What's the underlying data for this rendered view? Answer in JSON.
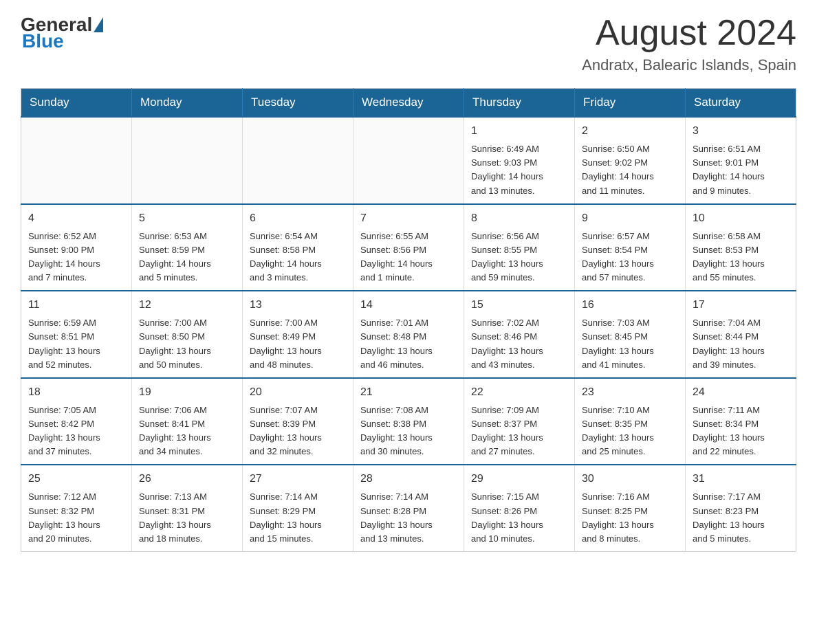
{
  "logo": {
    "general": "General",
    "blue": "Blue"
  },
  "header": {
    "month_title": "August 2024",
    "location": "Andratx, Balearic Islands, Spain"
  },
  "weekdays": [
    "Sunday",
    "Monday",
    "Tuesday",
    "Wednesday",
    "Thursday",
    "Friday",
    "Saturday"
  ],
  "weeks": [
    [
      {
        "day": "",
        "info": ""
      },
      {
        "day": "",
        "info": ""
      },
      {
        "day": "",
        "info": ""
      },
      {
        "day": "",
        "info": ""
      },
      {
        "day": "1",
        "info": "Sunrise: 6:49 AM\nSunset: 9:03 PM\nDaylight: 14 hours\nand 13 minutes."
      },
      {
        "day": "2",
        "info": "Sunrise: 6:50 AM\nSunset: 9:02 PM\nDaylight: 14 hours\nand 11 minutes."
      },
      {
        "day": "3",
        "info": "Sunrise: 6:51 AM\nSunset: 9:01 PM\nDaylight: 14 hours\nand 9 minutes."
      }
    ],
    [
      {
        "day": "4",
        "info": "Sunrise: 6:52 AM\nSunset: 9:00 PM\nDaylight: 14 hours\nand 7 minutes."
      },
      {
        "day": "5",
        "info": "Sunrise: 6:53 AM\nSunset: 8:59 PM\nDaylight: 14 hours\nand 5 minutes."
      },
      {
        "day": "6",
        "info": "Sunrise: 6:54 AM\nSunset: 8:58 PM\nDaylight: 14 hours\nand 3 minutes."
      },
      {
        "day": "7",
        "info": "Sunrise: 6:55 AM\nSunset: 8:56 PM\nDaylight: 14 hours\nand 1 minute."
      },
      {
        "day": "8",
        "info": "Sunrise: 6:56 AM\nSunset: 8:55 PM\nDaylight: 13 hours\nand 59 minutes."
      },
      {
        "day": "9",
        "info": "Sunrise: 6:57 AM\nSunset: 8:54 PM\nDaylight: 13 hours\nand 57 minutes."
      },
      {
        "day": "10",
        "info": "Sunrise: 6:58 AM\nSunset: 8:53 PM\nDaylight: 13 hours\nand 55 minutes."
      }
    ],
    [
      {
        "day": "11",
        "info": "Sunrise: 6:59 AM\nSunset: 8:51 PM\nDaylight: 13 hours\nand 52 minutes."
      },
      {
        "day": "12",
        "info": "Sunrise: 7:00 AM\nSunset: 8:50 PM\nDaylight: 13 hours\nand 50 minutes."
      },
      {
        "day": "13",
        "info": "Sunrise: 7:00 AM\nSunset: 8:49 PM\nDaylight: 13 hours\nand 48 minutes."
      },
      {
        "day": "14",
        "info": "Sunrise: 7:01 AM\nSunset: 8:48 PM\nDaylight: 13 hours\nand 46 minutes."
      },
      {
        "day": "15",
        "info": "Sunrise: 7:02 AM\nSunset: 8:46 PM\nDaylight: 13 hours\nand 43 minutes."
      },
      {
        "day": "16",
        "info": "Sunrise: 7:03 AM\nSunset: 8:45 PM\nDaylight: 13 hours\nand 41 minutes."
      },
      {
        "day": "17",
        "info": "Sunrise: 7:04 AM\nSunset: 8:44 PM\nDaylight: 13 hours\nand 39 minutes."
      }
    ],
    [
      {
        "day": "18",
        "info": "Sunrise: 7:05 AM\nSunset: 8:42 PM\nDaylight: 13 hours\nand 37 minutes."
      },
      {
        "day": "19",
        "info": "Sunrise: 7:06 AM\nSunset: 8:41 PM\nDaylight: 13 hours\nand 34 minutes."
      },
      {
        "day": "20",
        "info": "Sunrise: 7:07 AM\nSunset: 8:39 PM\nDaylight: 13 hours\nand 32 minutes."
      },
      {
        "day": "21",
        "info": "Sunrise: 7:08 AM\nSunset: 8:38 PM\nDaylight: 13 hours\nand 30 minutes."
      },
      {
        "day": "22",
        "info": "Sunrise: 7:09 AM\nSunset: 8:37 PM\nDaylight: 13 hours\nand 27 minutes."
      },
      {
        "day": "23",
        "info": "Sunrise: 7:10 AM\nSunset: 8:35 PM\nDaylight: 13 hours\nand 25 minutes."
      },
      {
        "day": "24",
        "info": "Sunrise: 7:11 AM\nSunset: 8:34 PM\nDaylight: 13 hours\nand 22 minutes."
      }
    ],
    [
      {
        "day": "25",
        "info": "Sunrise: 7:12 AM\nSunset: 8:32 PM\nDaylight: 13 hours\nand 20 minutes."
      },
      {
        "day": "26",
        "info": "Sunrise: 7:13 AM\nSunset: 8:31 PM\nDaylight: 13 hours\nand 18 minutes."
      },
      {
        "day": "27",
        "info": "Sunrise: 7:14 AM\nSunset: 8:29 PM\nDaylight: 13 hours\nand 15 minutes."
      },
      {
        "day": "28",
        "info": "Sunrise: 7:14 AM\nSunset: 8:28 PM\nDaylight: 13 hours\nand 13 minutes."
      },
      {
        "day": "29",
        "info": "Sunrise: 7:15 AM\nSunset: 8:26 PM\nDaylight: 13 hours\nand 10 minutes."
      },
      {
        "day": "30",
        "info": "Sunrise: 7:16 AM\nSunset: 8:25 PM\nDaylight: 13 hours\nand 8 minutes."
      },
      {
        "day": "31",
        "info": "Sunrise: 7:17 AM\nSunset: 8:23 PM\nDaylight: 13 hours\nand 5 minutes."
      }
    ]
  ]
}
